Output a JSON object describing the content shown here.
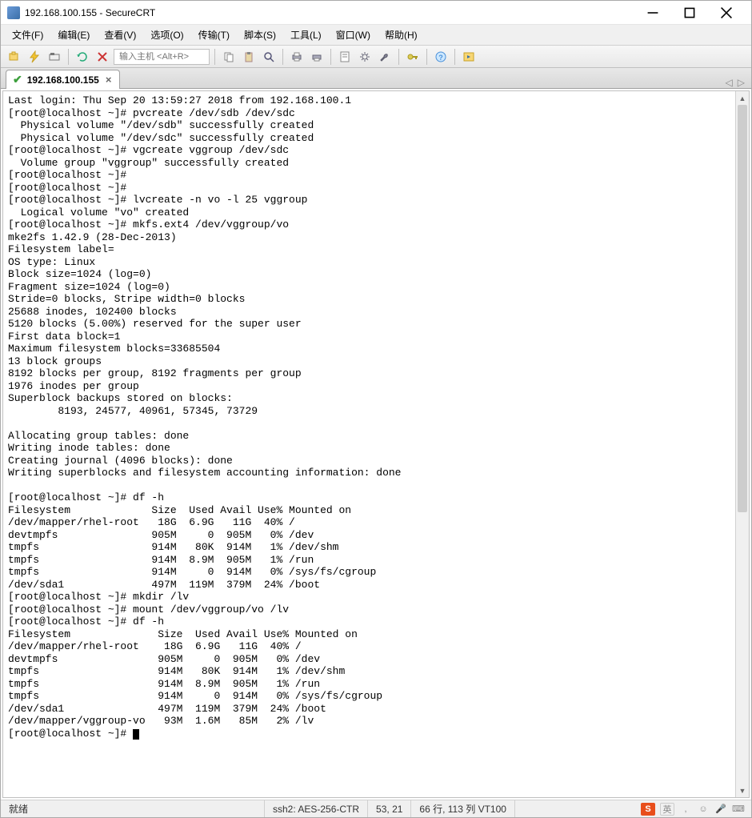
{
  "window": {
    "title": "192.168.100.155 - SecureCRT"
  },
  "menu": {
    "file": "文件(F)",
    "edit": "编辑(E)",
    "view": "查看(V)",
    "options": "选项(O)",
    "transfer": "传输(T)",
    "script": "脚本(S)",
    "tools": "工具(L)",
    "window": "窗口(W)",
    "help": "帮助(H)"
  },
  "toolbar": {
    "host_placeholder": "输入主机 <Alt+R>"
  },
  "tab": {
    "label": "192.168.100.155",
    "close": "×"
  },
  "tabnav": {
    "left": "◁",
    "right": "▷"
  },
  "terminal_lines": [
    "Last login: Thu Sep 20 13:59:27 2018 from 192.168.100.1",
    "[root@localhost ~]# pvcreate /dev/sdb /dev/sdc",
    "  Physical volume \"/dev/sdb\" successfully created",
    "  Physical volume \"/dev/sdc\" successfully created",
    "[root@localhost ~]# vgcreate vggroup /dev/sdc",
    "  Volume group \"vggroup\" successfully created",
    "[root@localhost ~]#",
    "[root@localhost ~]#",
    "[root@localhost ~]# lvcreate -n vo -l 25 vggroup",
    "  Logical volume \"vo\" created",
    "[root@localhost ~]# mkfs.ext4 /dev/vggroup/vo",
    "mke2fs 1.42.9 (28-Dec-2013)",
    "Filesystem label=",
    "OS type: Linux",
    "Block size=1024 (log=0)",
    "Fragment size=1024 (log=0)",
    "Stride=0 blocks, Stripe width=0 blocks",
    "25688 inodes, 102400 blocks",
    "5120 blocks (5.00%) reserved for the super user",
    "First data block=1",
    "Maximum filesystem blocks=33685504",
    "13 block groups",
    "8192 blocks per group, 8192 fragments per group",
    "1976 inodes per group",
    "Superblock backups stored on blocks:",
    "        8193, 24577, 40961, 57345, 73729",
    "",
    "Allocating group tables: done",
    "Writing inode tables: done",
    "Creating journal (4096 blocks): done",
    "Writing superblocks and filesystem accounting information: done",
    "",
    "[root@localhost ~]# df -h",
    "Filesystem             Size  Used Avail Use% Mounted on",
    "/dev/mapper/rhel-root   18G  6.9G   11G  40% /",
    "devtmpfs               905M     0  905M   0% /dev",
    "tmpfs                  914M   80K  914M   1% /dev/shm",
    "tmpfs                  914M  8.9M  905M   1% /run",
    "tmpfs                  914M     0  914M   0% /sys/fs/cgroup",
    "/dev/sda1              497M  119M  379M  24% /boot",
    "[root@localhost ~]# mkdir /lv",
    "[root@localhost ~]# mount /dev/vggroup/vo /lv",
    "[root@localhost ~]# df -h",
    "Filesystem              Size  Used Avail Use% Mounted on",
    "/dev/mapper/rhel-root    18G  6.9G   11G  40% /",
    "devtmpfs                905M     0  905M   0% /dev",
    "tmpfs                   914M   80K  914M   1% /dev/shm",
    "tmpfs                   914M  8.9M  905M   1% /run",
    "tmpfs                   914M     0  914M   0% /sys/fs/cgroup",
    "/dev/sda1               497M  119M  379M  24% /boot",
    "/dev/mapper/vggroup-vo   93M  1.6M   85M   2% /lv",
    "[root@localhost ~]# "
  ],
  "status": {
    "ready": "就绪",
    "proto": "ssh2: AES-256-CTR",
    "cursor": "53, 21",
    "size": "66 行, 113 列 VT100",
    "ime": "英"
  }
}
